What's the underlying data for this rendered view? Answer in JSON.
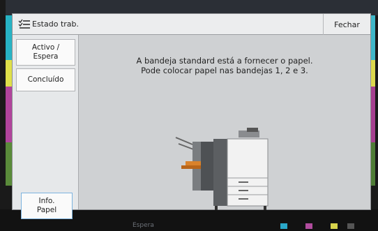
{
  "header": {
    "title": "Estado trab.",
    "close_label": "Fechar"
  },
  "sidebar": {
    "active_label": "Activo /\nEspera",
    "done_label": "Concluído",
    "paper_info_label": "Info.\nPapel"
  },
  "message": {
    "line1": "A bandeja standard está a fornecer o papel.",
    "line2": "Pode colocar papel nas bandejas 1, 2 e 3."
  },
  "background": {
    "status_text": "Espera"
  },
  "icons": {
    "header": "job-status-list-icon",
    "device": "printer-illustration-icon"
  },
  "colors": {
    "accent_cyan": "#27b3c4",
    "accent_yellow": "#dfe04a",
    "accent_magenta": "#b0449c",
    "accent_green": "#5a8b3a",
    "info_button_border": "#7cb3df"
  }
}
